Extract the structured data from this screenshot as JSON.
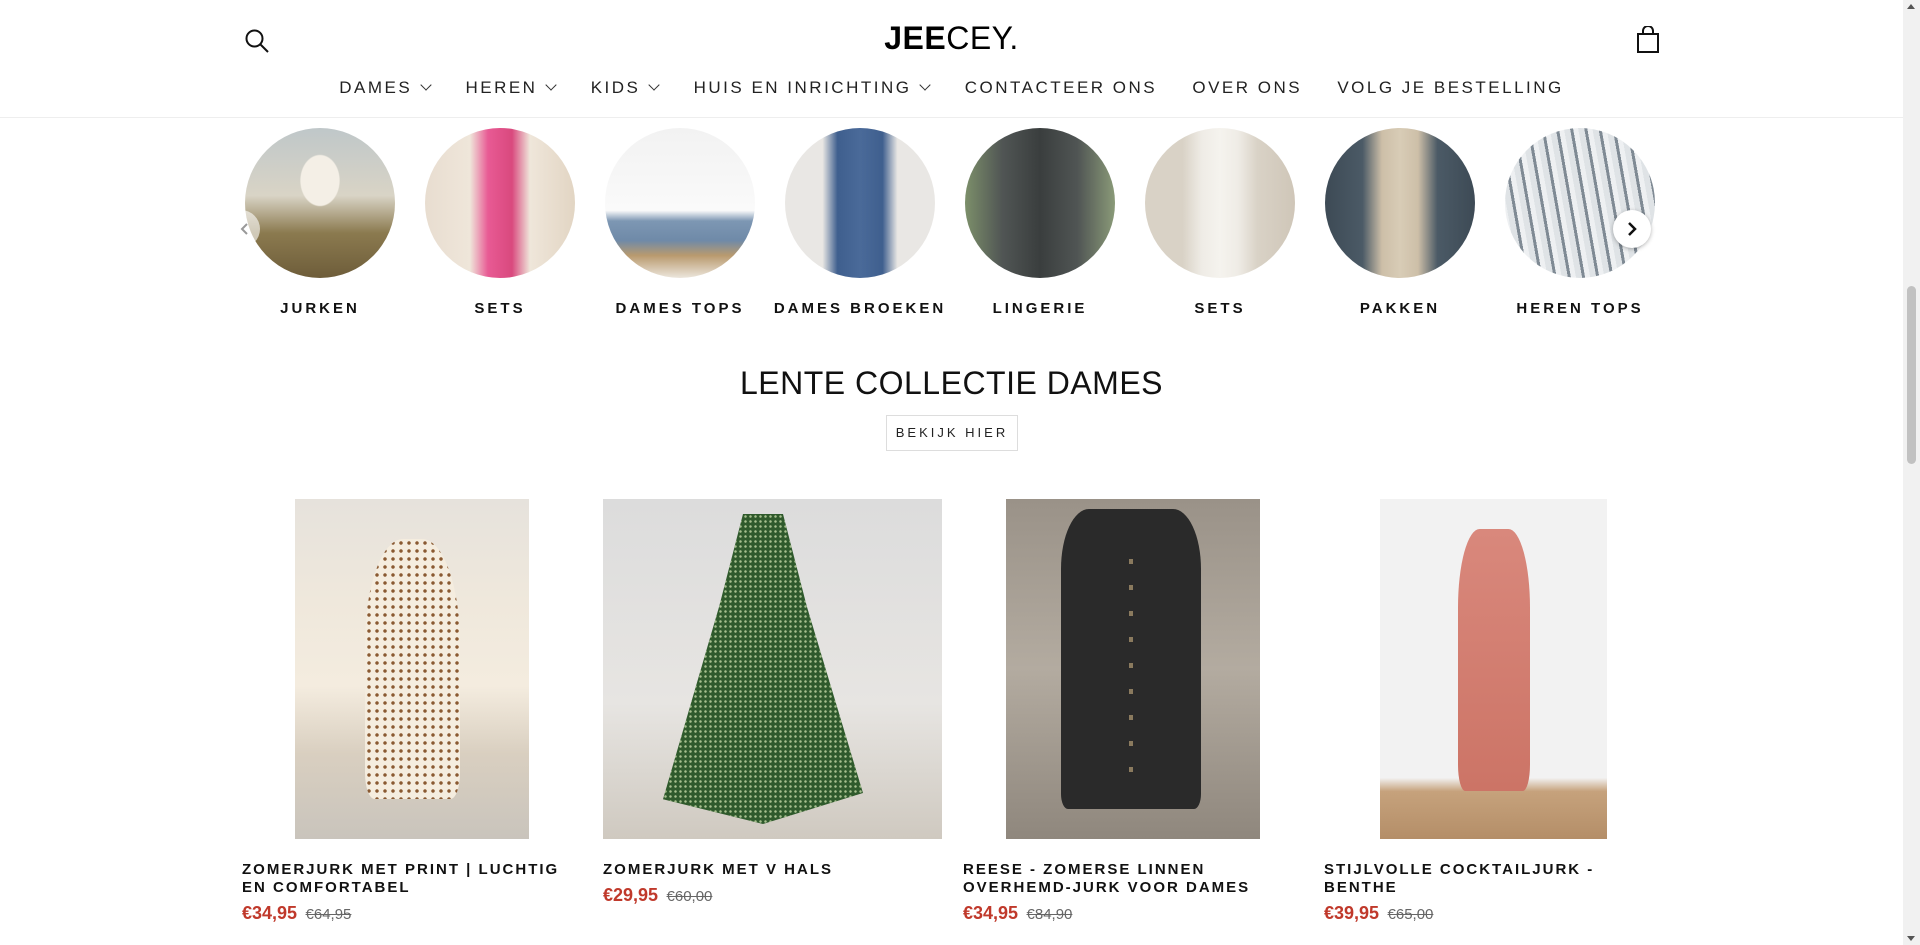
{
  "header": {
    "logo_bold": "JEE",
    "logo_light": "CEY.",
    "search_icon": "search-icon",
    "cart_icon": "shopping-bag-icon"
  },
  "nav": [
    {
      "label": "DAMES",
      "dropdown": true
    },
    {
      "label": "HEREN",
      "dropdown": true
    },
    {
      "label": "KIDS",
      "dropdown": true
    },
    {
      "label": "HUIS EN INRICHTING",
      "dropdown": true
    },
    {
      "label": "CONTACTEER ONS",
      "dropdown": false
    },
    {
      "label": "OVER ONS",
      "dropdown": false
    },
    {
      "label": "VOLG JE BESTELLING",
      "dropdown": false
    }
  ],
  "categories": [
    {
      "label": "JURKEN"
    },
    {
      "label": "SETS"
    },
    {
      "label": "DAMES TOPS"
    },
    {
      "label": "DAMES BROEKEN"
    },
    {
      "label": "LINGERIE"
    },
    {
      "label": "SETS"
    },
    {
      "label": "PAKKEN"
    },
    {
      "label": "HEREN TOPS"
    }
  ],
  "collection": {
    "title": "LENTE COLLECTIE DAMES",
    "button": "BEKIJK HIER"
  },
  "products": [
    {
      "title": "ZOMERJURK MET PRINT | LUCHTIG EN COMFORTABEL",
      "price": "€34,95",
      "compare_price": "€64,95"
    },
    {
      "title": "ZOMERJURK MET V HALS",
      "price": "€29,95",
      "compare_price": "€60,00"
    },
    {
      "title": "REESE - ZOMERSE LINNEN OVERHEMD-JURK VOOR DAMES",
      "price": "€34,95",
      "compare_price": "€84,90"
    },
    {
      "title": "STIJLVOLLE COCKTAILJURK - BENTHE",
      "price": "€39,95",
      "compare_price": "€65,00"
    }
  ],
  "colors": {
    "sale_price": "#c0392b",
    "text": "#111111"
  }
}
